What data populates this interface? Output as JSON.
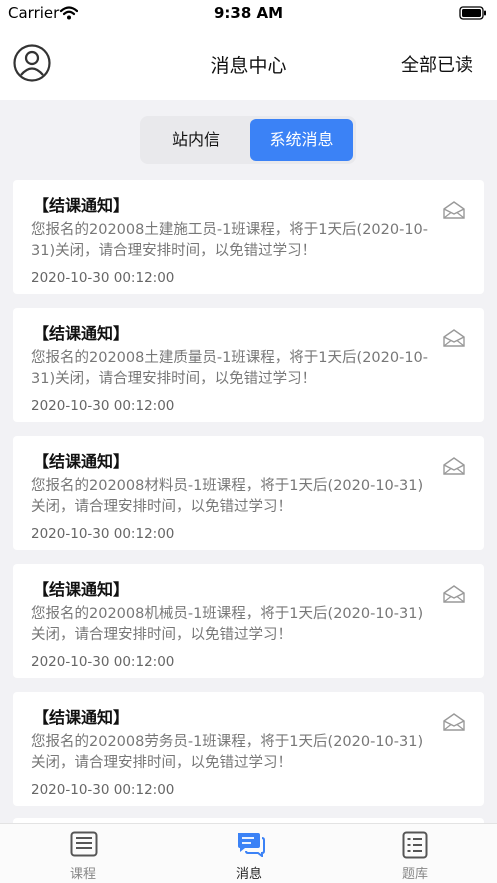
{
  "status_bar": {
    "carrier": "Carrier",
    "time": "9:38 AM"
  },
  "nav": {
    "title": "消息中心",
    "mark_all_read": "全部已读"
  },
  "segment": {
    "inbox": "站内信",
    "system": "系统消息",
    "active": "system"
  },
  "messages": [
    {
      "title": "【结课通知】",
      "body": "您报名的202008土建施工员-1班课程，将于1天后(2020-10-31)关闭，请合理安排时间，以免错过学习！",
      "time": "2020-10-30 00:12:00"
    },
    {
      "title": "【结课通知】",
      "body": "您报名的202008土建质量员-1班课程，将于1天后(2020-10-31)关闭，请合理安排时间，以免错过学习！",
      "time": "2020-10-30 00:12:00"
    },
    {
      "title": "【结课通知】",
      "body": "您报名的202008材料员-1班课程，将于1天后(2020-10-31)关闭，请合理安排时间，以免错过学习！",
      "time": "2020-10-30 00:12:00"
    },
    {
      "title": "【结课通知】",
      "body": "您报名的202008机械员-1班课程，将于1天后(2020-10-31)关闭，请合理安排时间，以免错过学习！",
      "time": "2020-10-30 00:12:00"
    },
    {
      "title": "【结课通知】",
      "body": "您报名的202008劳务员-1班课程，将于1天后(2020-10-31)关闭，请合理安排时间，以免错过学习！",
      "time": "2020-10-30 00:12:00"
    }
  ],
  "tabs": [
    {
      "label": "课程",
      "icon": "course-icon"
    },
    {
      "label": "消息",
      "icon": "message-icon"
    },
    {
      "label": "题库",
      "icon": "question-bank-icon"
    }
  ],
  "colors": {
    "accent": "#3b82f6",
    "background": "#f2f2f5",
    "card": "#ffffff"
  }
}
